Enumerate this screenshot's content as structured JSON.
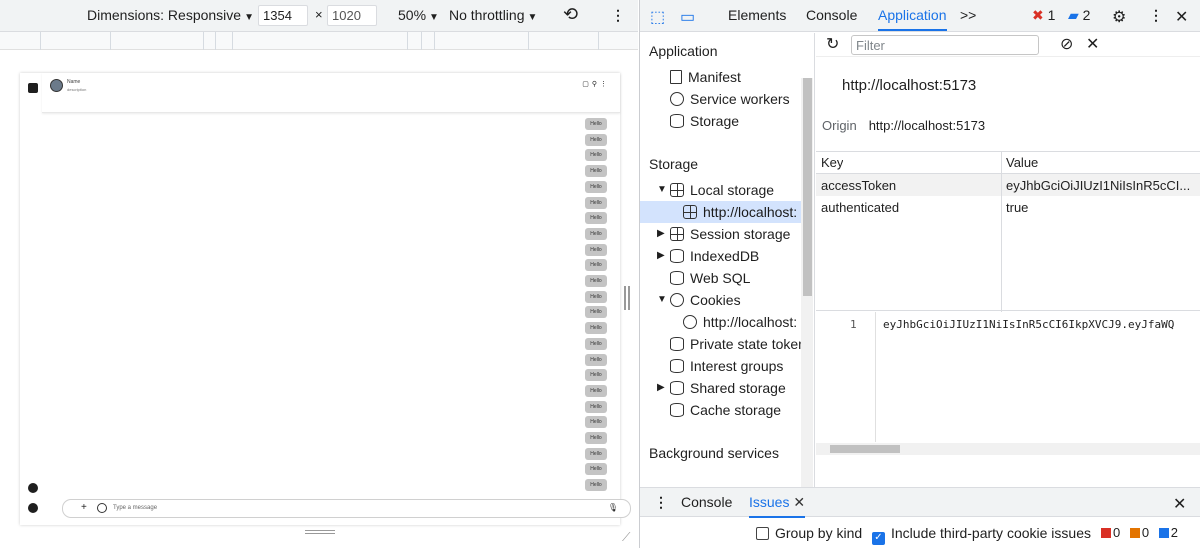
{
  "device_toolbar": {
    "dimensions_label": "Dimensions: Responsive",
    "width": "1354",
    "height": "1020",
    "times": "×",
    "zoom": "50%",
    "throttling": "No throttling"
  },
  "chat": {
    "name": "Name",
    "description": "description",
    "message_text": "Hello",
    "message_count": 24,
    "input_placeholder": "Type a message"
  },
  "devtools": {
    "tabs": [
      "Elements",
      "Console",
      "Application"
    ],
    "active_tab": "Application",
    "more_tabs": ">>",
    "errors_count": "1",
    "messages_count": "2"
  },
  "sidebar": {
    "application_title": "Application",
    "application_items": [
      "Manifest",
      "Service workers",
      "Storage"
    ],
    "storage_title": "Storage",
    "local_storage": "Local storage",
    "local_storage_origin": "http://localhost:",
    "session_storage": "Session storage",
    "indexeddb": "IndexedDB",
    "websql": "Web SQL",
    "cookies": "Cookies",
    "cookies_origin": "http://localhost:",
    "private_state_tokens": "Private state token",
    "interest_groups": "Interest groups",
    "shared_storage": "Shared storage",
    "cache_storage": "Cache storage",
    "background_title": "Background services"
  },
  "storage_view": {
    "filter_placeholder": "Filter",
    "origin_title": "http://localhost:5173",
    "origin_label": "Origin",
    "origin_value": "http://localhost:5173",
    "columns": [
      "Key",
      "Value"
    ],
    "rows": [
      {
        "key": "accessToken",
        "value": "eyJhbGciOiJIUzI1NiIsInR5cCI..."
      },
      {
        "key": "authenticated",
        "value": "true"
      }
    ],
    "preview_line_number": "1",
    "preview_code": "eyJhbGciOiJIUzI1NiIsInR5cCI6IkpXVCJ9.eyJfaWQ"
  },
  "drawer": {
    "console_tab": "Console",
    "issues_tab": "Issues",
    "group_by_kind": "Group by kind",
    "include_third_party": "Include third-party cookie issues",
    "issue_counts": [
      "0",
      "0",
      "2"
    ],
    "issue_colors": [
      "#d93025",
      "#e37400",
      "#1a73e8"
    ]
  }
}
